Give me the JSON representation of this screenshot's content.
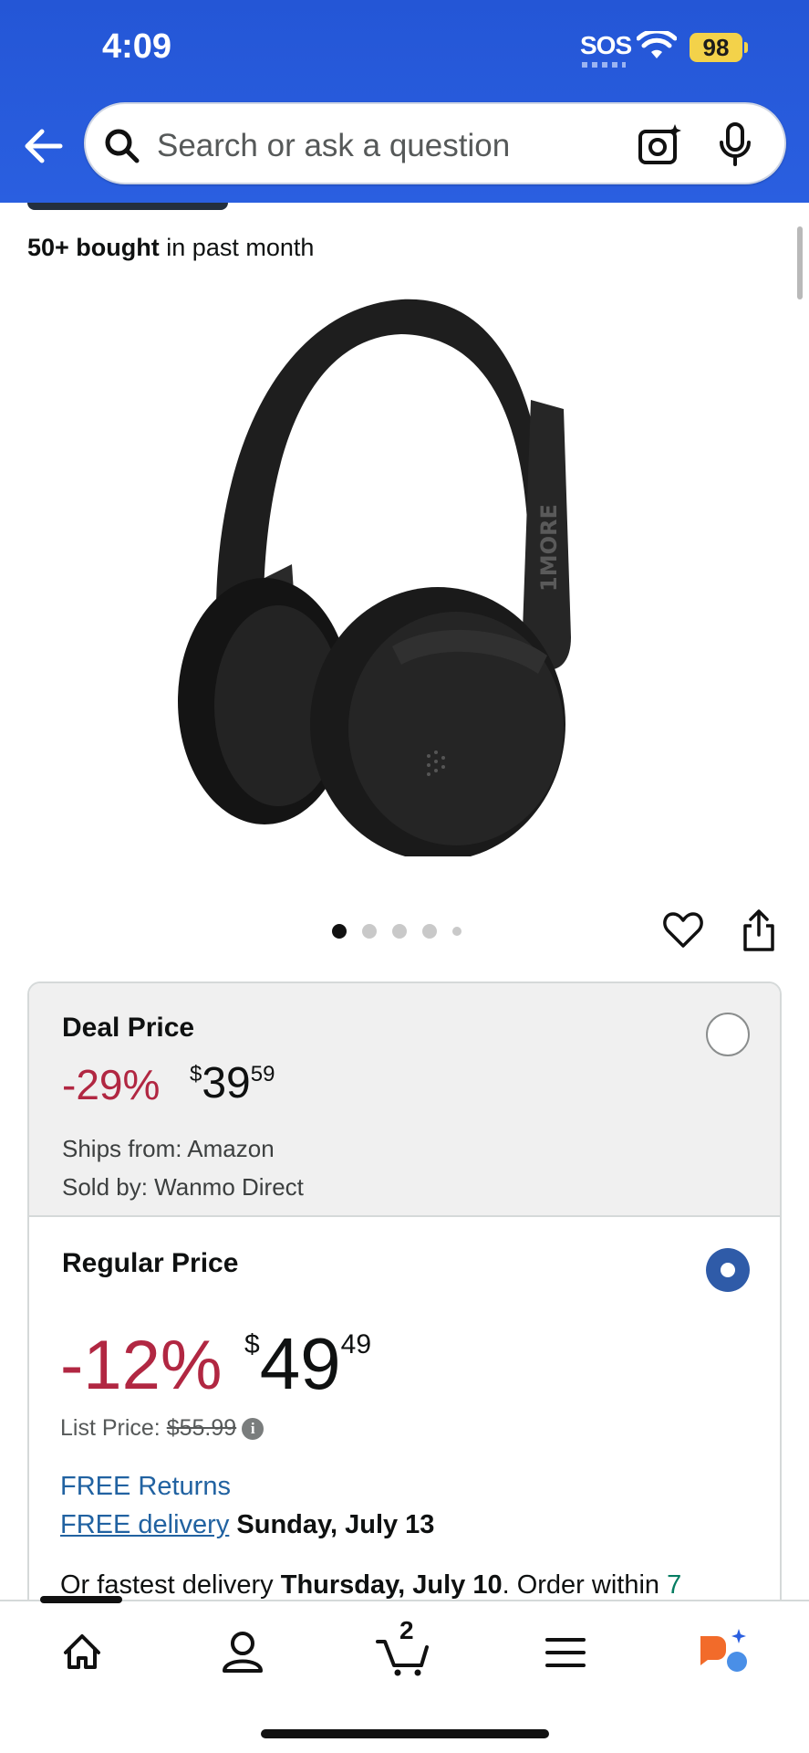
{
  "status_bar": {
    "time": "4:09",
    "sos": "SOS",
    "battery": "98"
  },
  "search": {
    "placeholder": "Search or ask a question"
  },
  "product": {
    "bought_count": "50+ bought",
    "bought_suffix": "in past month",
    "image_alt": "Black over-ear headphones",
    "brand_print": "1MORE",
    "image_count": 5,
    "active_image_index": 0
  },
  "deal_option": {
    "title": "Deal Price",
    "discount": "-29%",
    "currency": "$",
    "price_whole": "39",
    "price_fraction": "59",
    "ships_from": "Ships from: Amazon",
    "sold_by": "Sold by: Wanmo Direct",
    "selected": false
  },
  "regular_option": {
    "title": "Regular Price",
    "discount": "-12%",
    "currency": "$",
    "price_whole": "49",
    "price_fraction": "49",
    "list_price_label": "List Price:",
    "list_price": "$55.99",
    "free_returns": "FREE Returns",
    "free_delivery_link": "FREE delivery",
    "delivery_date": "Sunday, July 13",
    "fastest_prefix": "Or fastest delivery",
    "fastest_date": "Thursday, July 10",
    "order_within": ". Order within",
    "order_within_value": "7",
    "selected": true
  },
  "bottom_nav": {
    "cart_count": "2",
    "items": [
      "home",
      "account",
      "cart",
      "menu",
      "rufus"
    ]
  },
  "colors": {
    "header": "#2456d6",
    "discount": "#b12742",
    "link": "#2162a1",
    "radio_selected": "#2f5ba8"
  }
}
